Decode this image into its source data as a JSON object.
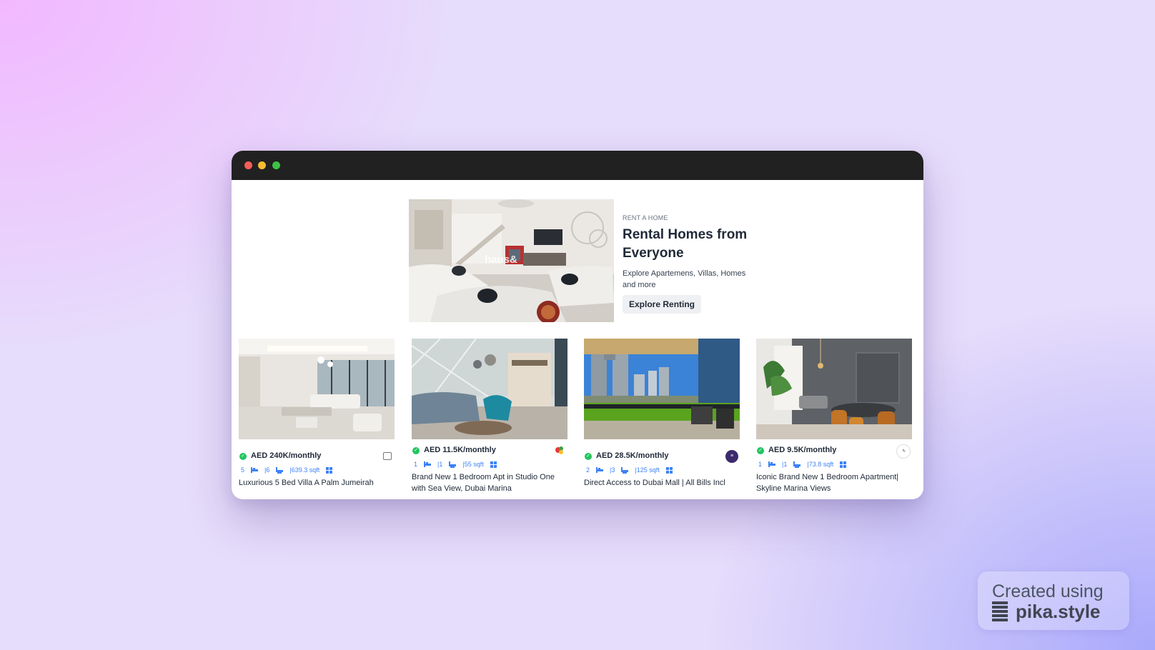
{
  "hero": {
    "eyebrow": "RENT A HOME",
    "title": "Rental Homes from Everyone",
    "description": "Explore Apartemens, Villas, Homes and more",
    "button_label": "Explore Renting",
    "image_watermark": "haus&"
  },
  "listings": [
    {
      "price": "AED 240K/monthly",
      "beds": "5",
      "baths": "|6",
      "area": "|639.3 sqft",
      "title": "Luxurious 5 Bed Villa A Palm Jumeirah",
      "agency_icon": "agency-logo-box"
    },
    {
      "price": "AED 11.5K/monthly",
      "beds": "1",
      "baths": "|1",
      "area": "|55 sqft",
      "title": "Brand New 1 Bedroom Apt in Studio One with Sea View, Dubai Marina",
      "agency_icon": "agency-logo-colorful"
    },
    {
      "price": "AED 28.5K/monthly",
      "beds": "2",
      "baths": "|3",
      "area": "|125 sqft",
      "title": "Direct Access to Dubai Mall | All Bills Incl",
      "agency_icon": "agency-logo-purple"
    },
    {
      "price": "AED 9.5K/monthly",
      "beds": "1",
      "baths": "|1",
      "area": "|73.8 sqft",
      "title": "Iconic Brand New 1 Bedroom Apartment| Skyline Marina Views",
      "agency_icon": "agency-logo-script"
    }
  ],
  "watermark": {
    "line1": "Created using",
    "line2": "pika.style"
  },
  "colors": {
    "titlebar": "#212121",
    "accent_blue": "#3b82f6",
    "verified_green": "#22c55e"
  }
}
